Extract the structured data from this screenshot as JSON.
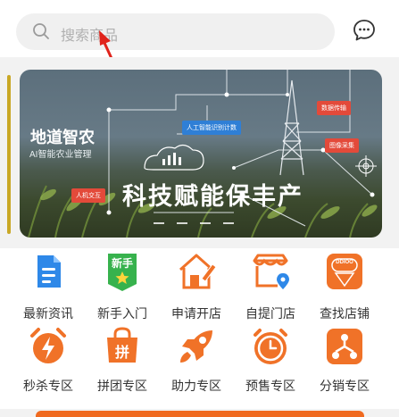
{
  "search": {
    "placeholder": "搜索商品",
    "icon": "search-icon"
  },
  "header": {
    "chat_icon": "chat-bubble-icon"
  },
  "banner": {
    "title": "地道智农",
    "subtitle": "AI智能农业管理",
    "slogan": "科技赋能保丰产",
    "tags": [
      "人工智能识别计数",
      "数据传输",
      "图像采集",
      "人机交互"
    ]
  },
  "menu": {
    "row1": [
      {
        "label": "最新资讯",
        "icon": "news-document-icon",
        "color": "#2e88e8"
      },
      {
        "label": "新手入门",
        "icon": "beginner-badge-icon",
        "color": "#37b24d",
        "badge_text": "新手"
      },
      {
        "label": "申请开店",
        "icon": "apply-store-icon",
        "color": "#f07228"
      },
      {
        "label": "自提门店",
        "icon": "pickup-store-icon",
        "color": "#f07228"
      },
      {
        "label": "查找店铺",
        "icon": "find-store-icon",
        "color": "#f07228",
        "badge_text": "DDIOO"
      }
    ],
    "row2": [
      {
        "label": "秒杀专区",
        "icon": "flash-sale-icon",
        "color": "#f07228"
      },
      {
        "label": "拼团专区",
        "icon": "group-buy-icon",
        "color": "#f07228",
        "badge_text": "拼"
      },
      {
        "label": "助力专区",
        "icon": "rocket-icon",
        "color": "#f07228"
      },
      {
        "label": "预售专区",
        "icon": "presale-clock-icon",
        "color": "#f07228"
      },
      {
        "label": "分销专区",
        "icon": "distribution-icon",
        "color": "#f07228"
      }
    ]
  }
}
